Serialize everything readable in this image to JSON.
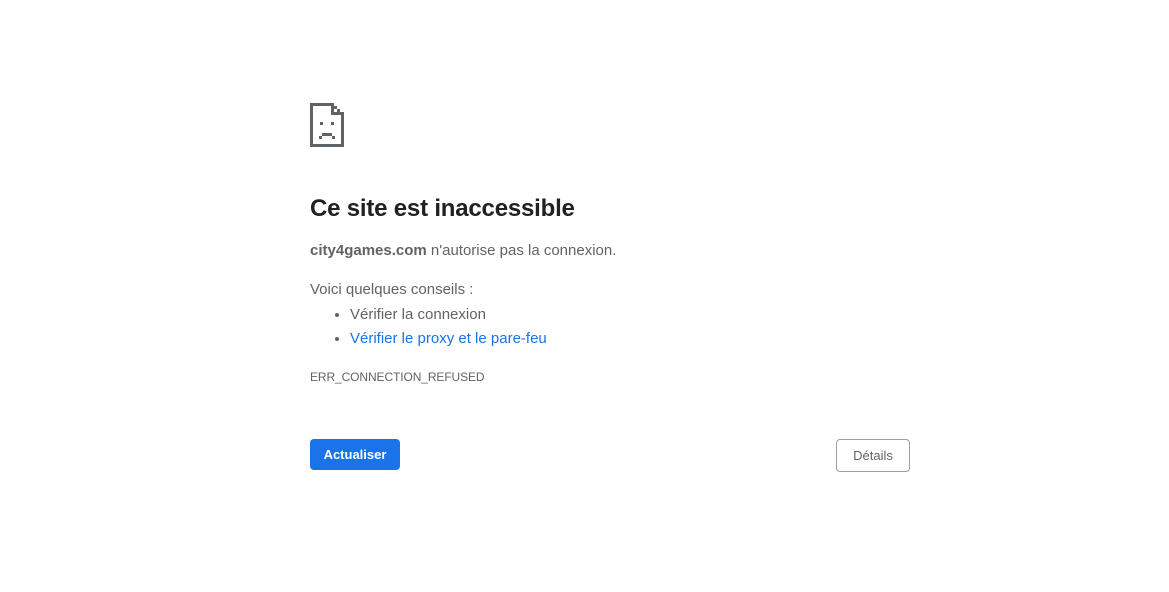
{
  "page": {
    "icon": "sad-page-icon",
    "title": "Ce site est inaccessible",
    "message": {
      "host": "city4games.com",
      "text": " n'autorise pas la connexion."
    },
    "tips_heading": "Voici quelques conseils :",
    "tips": [
      {
        "label": "Vérifier la connexion",
        "link": false
      },
      {
        "label": "Vérifier le proxy et le pare-feu",
        "link": true
      }
    ],
    "error_code": "ERR_CONNECTION_REFUSED",
    "reload_button": "Actualiser",
    "details_button": "Détails"
  },
  "colors": {
    "accent": "#1a73e8",
    "title": "#202124",
    "text": "#5f6368",
    "icon": "#5f6368"
  }
}
